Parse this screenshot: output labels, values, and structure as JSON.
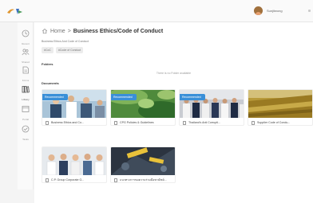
{
  "header": {
    "user_name": "Sunjitwong"
  },
  "sidebar": {
    "items": [
      {
        "label": "Recent",
        "icon": "clock-icon"
      },
      {
        "label": "Shared",
        "icon": "people-icon"
      },
      {
        "label": "Forms",
        "icon": "document-icon"
      },
      {
        "label": "Library",
        "icon": "library-icon",
        "active": true
      },
      {
        "label": "Portal",
        "icon": "portal-icon"
      },
      {
        "label": "Tasks",
        "icon": "check-circle-icon"
      }
    ]
  },
  "breadcrumb": {
    "home": "Home",
    "separator": ">",
    "current": "Business Ethics/Code of Conduct"
  },
  "page": {
    "subtitle": "Business Ethics And Code of Conduct",
    "tags": [
      "#CoC",
      "#Code of Conduct"
    ]
  },
  "folders": {
    "label": "Folders",
    "empty_message": "There is no Folder available"
  },
  "documents": {
    "label": "Documents",
    "badge_text": "Recommended",
    "items": [
      {
        "title": "Business Ethics and Co...",
        "recommended": true
      },
      {
        "title": "CPG Policies & Guidelines",
        "recommended": true
      },
      {
        "title": "Thailand's Anti Corrupti...",
        "recommended": true
      },
      {
        "title": "Supplier Code of Condu...",
        "recommended": false
      },
      {
        "title": "C.P. Group Corporate G...",
        "recommended": false
      },
      {
        "title": "แนวทางการขอความร่วมมือพาณิชย์...",
        "recommended": false
      }
    ]
  },
  "colors": {
    "accent": "#3a8fd8",
    "background": "#f4f4f4"
  }
}
